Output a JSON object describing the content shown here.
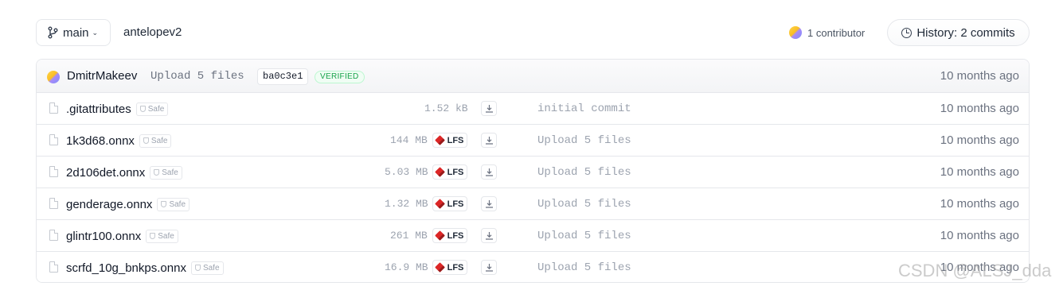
{
  "branch": {
    "label": "main"
  },
  "repo": {
    "path": "antelopev2"
  },
  "contributors": {
    "label": "1 contributor"
  },
  "history": {
    "label": "History: 2 commits"
  },
  "last_commit": {
    "author": "DmitrMakeev",
    "message": "Upload 5 files",
    "hash": "ba0c3e1",
    "badge": "VERIFIED",
    "time": "10 months ago"
  },
  "files": [
    {
      "name": ".gitattributes",
      "safe": "Safe",
      "size": "1.52 kB",
      "lfs": "",
      "message": "initial commit",
      "time": "10 months ago"
    },
    {
      "name": "1k3d68.onnx",
      "safe": "Safe",
      "size": "144 MB",
      "lfs": "LFS",
      "message": "Upload 5 files",
      "time": "10 months ago"
    },
    {
      "name": "2d106det.onnx",
      "safe": "Safe",
      "size": "5.03 MB",
      "lfs": "LFS",
      "message": "Upload 5 files",
      "time": "10 months ago"
    },
    {
      "name": "genderage.onnx",
      "safe": "Safe",
      "size": "1.32 MB",
      "lfs": "LFS",
      "message": "Upload 5 files",
      "time": "10 months ago"
    },
    {
      "name": "glintr100.onnx",
      "safe": "Safe",
      "size": "261 MB",
      "lfs": "LFS",
      "message": "Upload 5 files",
      "time": "10 months ago"
    },
    {
      "name": "scrfd_10g_bnkps.onnx",
      "safe": "Safe",
      "size": "16.9 MB",
      "lfs": "LFS",
      "message": "Upload 5 files",
      "time": "10 months ago"
    }
  ],
  "watermark": "CSDN @ALSJ_dda"
}
